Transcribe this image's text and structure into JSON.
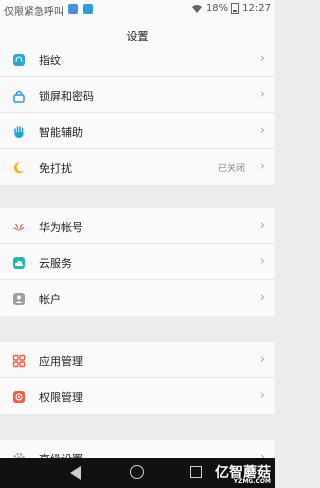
{
  "status_bar": {
    "carrier": "仅限紧急呼叫",
    "battery": "18%",
    "time": "12:27"
  },
  "title": "设置",
  "group1": [
    {
      "label": "指纹",
      "icon": "fingerprint-icon",
      "color": "#2ea9d6"
    },
    {
      "label": "锁屏和密码",
      "icon": "lock-icon",
      "color": "#2b98e0"
    },
    {
      "label": "智能辅助",
      "icon": "hand-icon",
      "color": "#25a1df"
    },
    {
      "label": "免打扰",
      "icon": "moon-icon",
      "color": "#f4b400",
      "value": "已关闭"
    }
  ],
  "group2": [
    {
      "label": "华为帐号",
      "icon": "huawei-icon",
      "color": "#e53935"
    },
    {
      "label": "云服务",
      "icon": "cloud-icon",
      "color": "#20b9a8"
    },
    {
      "label": "帐户",
      "icon": "person-icon",
      "color": "#9e9e9e"
    }
  ],
  "group3": [
    {
      "label": "应用管理",
      "icon": "apps-icon",
      "color": "#f15b3f"
    },
    {
      "label": "权限管理",
      "icon": "permission-icon",
      "color": "#f15b3f"
    }
  ],
  "group4": [
    {
      "label": "高级设置",
      "icon": "gear-icon",
      "color": "#9e9e9e"
    }
  ],
  "watermark": {
    "text": "亿智蘑菇",
    "sub": "YZMG.COM"
  }
}
